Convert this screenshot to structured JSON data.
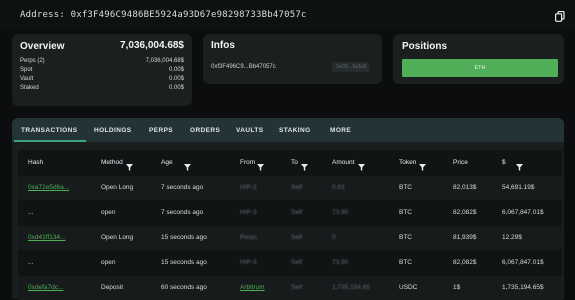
{
  "address": {
    "label": "Address:",
    "value": "0xf3F496C9486BE5924a93D67e98298733Bb47057c",
    "copy_icon": "copy-icon"
  },
  "overview": {
    "title": "Overview",
    "total": "7,036,004.68$",
    "rows": [
      {
        "label": "Perps (2)",
        "value": "7,036,004.68$"
      },
      {
        "label": "Spot",
        "value": "0.00$"
      },
      {
        "label": "Vault",
        "value": "0.00$"
      },
      {
        "label": "Staked",
        "value": "0.00$"
      }
    ]
  },
  "infos": {
    "title": "Infos",
    "short_address": "0xf3F496C9...Bb47057c",
    "chip": "0x00...fa3a9"
  },
  "positions": {
    "title": "Positions",
    "bar_label": "ETH"
  },
  "tabs": [
    "TRANSACTIONS",
    "HOLDINGS",
    "PERPS",
    "ORDERS",
    "VAULTS",
    "STAKING",
    "MORE"
  ],
  "table": {
    "headers": [
      "Hash",
      "Method",
      "Age",
      "From",
      "To",
      "Amount",
      "Token",
      "Price",
      "$"
    ],
    "rows": [
      {
        "hash": "0xa72e5d6a...",
        "method": "Open Long",
        "age": "7 seconds ago",
        "from": "HIP-3",
        "to": "Self",
        "amount": "0.63",
        "token": "BTC",
        "price": "82,013$",
        "usd": "54,691.19$"
      },
      {
        "hash": "...",
        "method": "open",
        "age": "7 seconds ago",
        "from": "HIP-3",
        "to": "Self",
        "amount": "73.90",
        "token": "BTC",
        "price": "82,082$",
        "usd": "6,067,847.01$"
      },
      {
        "hash": "0xd41ff134...",
        "method": "Open Long",
        "age": "15 seconds ago",
        "from": "Perps",
        "to": "Self",
        "amount": "0",
        "token": "BTC",
        "price": "81,939$",
        "usd": "12.29$"
      },
      {
        "hash": "...",
        "method": "open",
        "age": "15 seconds ago",
        "from": "HIP-3",
        "to": "Self",
        "amount": "73.90",
        "token": "BTC",
        "price": "82,082$",
        "usd": "6,067,847.01$"
      },
      {
        "hash": "0xdefa7dc...",
        "method": "Deposit",
        "age": "60 seconds ago",
        "from": "Arbitrum",
        "to": "Self",
        "amount": "1,735,194.65",
        "token": "USDC",
        "price": "1$",
        "usd": "1,735,194.65$"
      }
    ]
  },
  "colors": {
    "accent": "#4fae57",
    "tab_bar": "#243436",
    "card": "#1b1f20",
    "background": "#0b0d0e"
  }
}
